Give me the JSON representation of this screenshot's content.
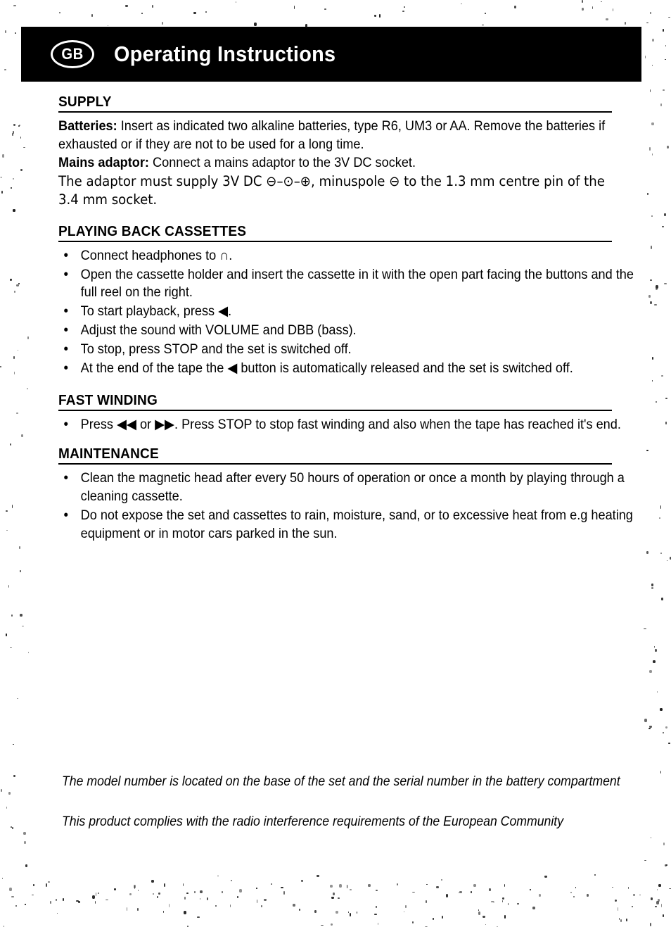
{
  "document": {
    "language_badge": "GB",
    "title": "Operating Instructions",
    "header_background": "#000000",
    "header_text_color": "#ffffff"
  },
  "sections": [
    {
      "id": "supply",
      "heading": "SUPPLY",
      "paragraphs": [
        {
          "lead": "Batteries:",
          "text": " Insert as indicated two alkaline batteries, type R6, UM3 or AA. Remove the batteries if exhausted or if they are not to be used for a long time."
        },
        {
          "lead": "Mains adaptor:",
          "text": " Connect a mains adaptor to the 3V DC socket."
        },
        {
          "lead": "",
          "text": "The adaptor must supply 3V DC ⊖–⊙–⊕, minuspole ⊖ to the 1.3 mm centre pin of the 3.4 mm socket."
        }
      ],
      "bullets": []
    },
    {
      "id": "playing-back-cassettes",
      "heading": "PLAYING BACK CASSETTES",
      "paragraphs": [],
      "bullets": [
        "Connect headphones to ∩.",
        "Open the cassette holder and insert the cassette in it with the open part facing the buttons and the full reel on the right.",
        "To start playback, press ◀.",
        "Adjust the sound with VOLUME and DBB (bass).",
        "To stop, press STOP and the set is switched off.",
        "At the end of the tape the ◀ button is automatically released and the set is switched off."
      ]
    },
    {
      "id": "fast-winding",
      "heading": "FAST WINDING",
      "paragraphs": [],
      "bullets": [
        "Press ◀◀ or ▶▶. Press STOP to stop fast winding and also when the tape has reached it's end."
      ]
    },
    {
      "id": "maintenance",
      "heading": "MAINTENANCE",
      "paragraphs": [],
      "bullets": [
        "Clean the magnetic head after every 50 hours of operation or once a month by playing through a cleaning cassette.",
        "Do not expose the set and cassettes to rain, moisture, sand, or to excessive heat from e.g  heating equipment or in motor cars parked in the sun."
      ]
    }
  ],
  "footer": {
    "note_model": "The model number is located on the base of the set and the serial number in the battery compartment",
    "note_compliance": "This product complies with the radio interference requirements of the European Community"
  }
}
